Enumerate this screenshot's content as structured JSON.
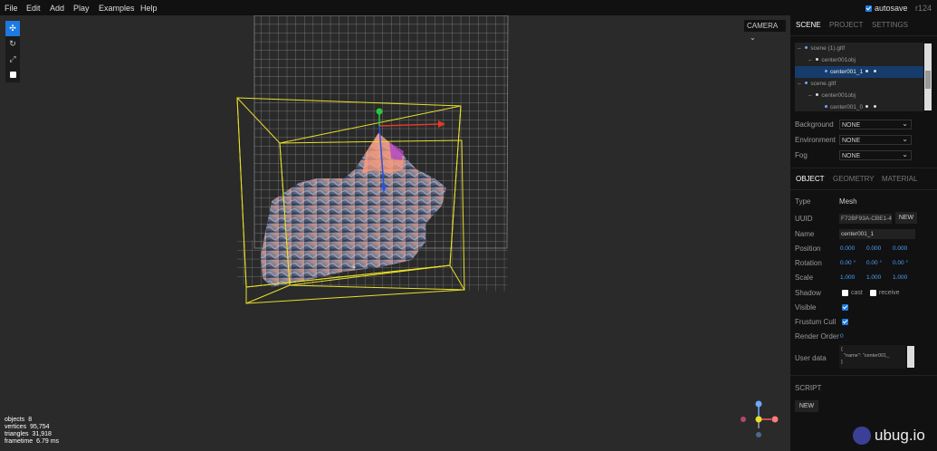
{
  "menubar": {
    "items": [
      "File",
      "Edit",
      "Add",
      "Play",
      "Examples",
      "Help"
    ],
    "autosave_label": "autosave",
    "autosave_checked": true,
    "revision": "r124"
  },
  "viewport": {
    "camera_select": "CAMERA",
    "toolbar": [
      "translate-icon",
      "rotate-icon",
      "scale-icon",
      "local-icon"
    ],
    "info": {
      "objects_label": "objects",
      "objects": "8",
      "vertices_label": "vertices",
      "vertices": "95,754",
      "triangles_label": "triangles",
      "triangles": "31,918",
      "frametime_label": "frametime",
      "frametime": "6.79 ms"
    }
  },
  "sidebar": {
    "tabs": [
      "SCENE",
      "PROJECT",
      "SETTINGS"
    ],
    "outliner": [
      {
        "label": "scene (1).gltf",
        "indent": 0
      },
      {
        "label": "center001obj",
        "indent": 1
      },
      {
        "label": "center001_1",
        "indent": 2,
        "selected": true
      },
      {
        "label": "scene.gltf",
        "indent": 0
      },
      {
        "label": "center001obj",
        "indent": 1
      },
      {
        "label": "center001_0",
        "indent": 2
      }
    ],
    "scene_props": {
      "background_label": "Background",
      "background_value": "NONE",
      "environment_label": "Environment",
      "environment_value": "NONE",
      "fog_label": "Fog",
      "fog_value": "NONE"
    },
    "object_tabs": [
      "OBJECT",
      "GEOMETRY",
      "MATERIAL"
    ],
    "object": {
      "type_label": "Type",
      "type_value": "Mesh",
      "uuid_label": "UUID",
      "uuid_value": "F72BF93A-CBE1-4",
      "uuid_new": "NEW",
      "name_label": "Name",
      "name_value": "center001_1",
      "position_label": "Position",
      "position": [
        "0.000",
        "0.000",
        "0.000"
      ],
      "rotation_label": "Rotation",
      "rotation": [
        "0.00 °",
        "0.00 °",
        "0.00 °"
      ],
      "scale_label": "Scale",
      "scale": [
        "1.000",
        "1.000",
        "1.000"
      ],
      "shadow_label": "Shadow",
      "shadow_cast": "cast",
      "shadow_receive": "receive",
      "visible_label": "Visible",
      "frustum_label": "Frustum Cull",
      "render_order_label": "Render Order",
      "render_order": "0",
      "userdata_label": "User data",
      "userdata_value": "{\n  \"name\": \"center001_\n}"
    },
    "script_label": "SCRIPT",
    "script_new": "NEW",
    "brand": "ubug.io"
  },
  "colors": {
    "accent": "#1e7ae0",
    "selection": "#153c6b",
    "bbox": "#e8e02a"
  }
}
